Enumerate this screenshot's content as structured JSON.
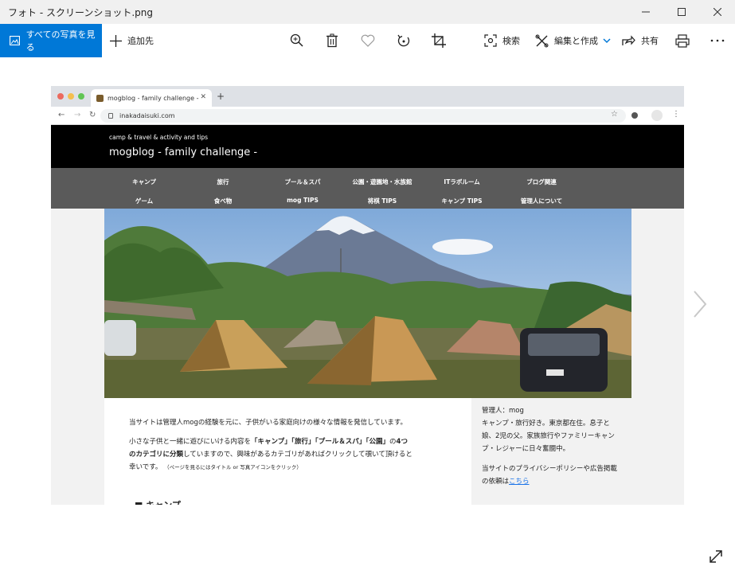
{
  "window": {
    "title": "フォト - スクリーンショット.png"
  },
  "toolbar": {
    "all_photos": "すべての写真を見る",
    "add_to": "追加先",
    "search": "検索",
    "edit_create": "編集と作成",
    "share": "共有"
  },
  "browser": {
    "tab_title": "mogblog - family challenge -",
    "url": "inakadaisuki.com"
  },
  "site": {
    "tagline": "camp & travel & activity and tips",
    "title": "mogblog - family challenge -",
    "menu_row1": [
      "キャンプ",
      "旅行",
      "プール＆スパ",
      "公園・遊園地・水族館",
      "ITラボルーム",
      "ブログ関連"
    ],
    "menu_row2": [
      "ゲーム",
      "食べ物",
      "mog TIPS",
      "将棋 TIPS",
      "キャンプ TIPS",
      "管理人について"
    ]
  },
  "article": {
    "intro": "当サイトは管理人mogの経験を元に、子供がいる家庭向けの様々な情報を発信しています。",
    "line1_a": "小さな子供と一緒に遊びにいける内容を",
    "line1_b": "「キャンプ」「旅行」「プール＆スパ」「公園」",
    "line1_c": "の",
    "line1_d": "4つ",
    "line2_a": "のカテゴリに分類",
    "line2_b": "していますので、興味があるカテゴリがあればクリックして覗いて頂けると",
    "line3_a": "幸いです。",
    "line3_b": "（ページを見るにはタイトル or 写真アイコンをクリック）",
    "section_heading": "■ キャンプ"
  },
  "sidebar": {
    "admin": "管理人：mog",
    "bio1": "キャンプ・旅行好き。東京都在住。息子と",
    "bio2": "娘、2児の父。家族旅行やファミリーキャン",
    "bio3": "プ・レジャーに日々奮闘中。",
    "privacy1": "当サイトのプライバシーポリシーや広告掲載",
    "privacy2": "の依頼は",
    "privacy_link": "こちら"
  },
  "colors": {
    "accent": "#0078d7",
    "site_header": "#000000",
    "menu_bar": "#5a5a5a"
  },
  "icons": [
    "photo-icon",
    "plus-icon",
    "zoom-icon",
    "delete-icon",
    "heart-icon",
    "rotate-icon",
    "crop-icon",
    "search-icon",
    "edit-icon",
    "chevron-down-icon",
    "share-icon",
    "print-icon",
    "more-icon",
    "minimize-icon",
    "maximize-icon",
    "close-icon",
    "next-arrow-icon",
    "fullscreen-icon"
  ]
}
